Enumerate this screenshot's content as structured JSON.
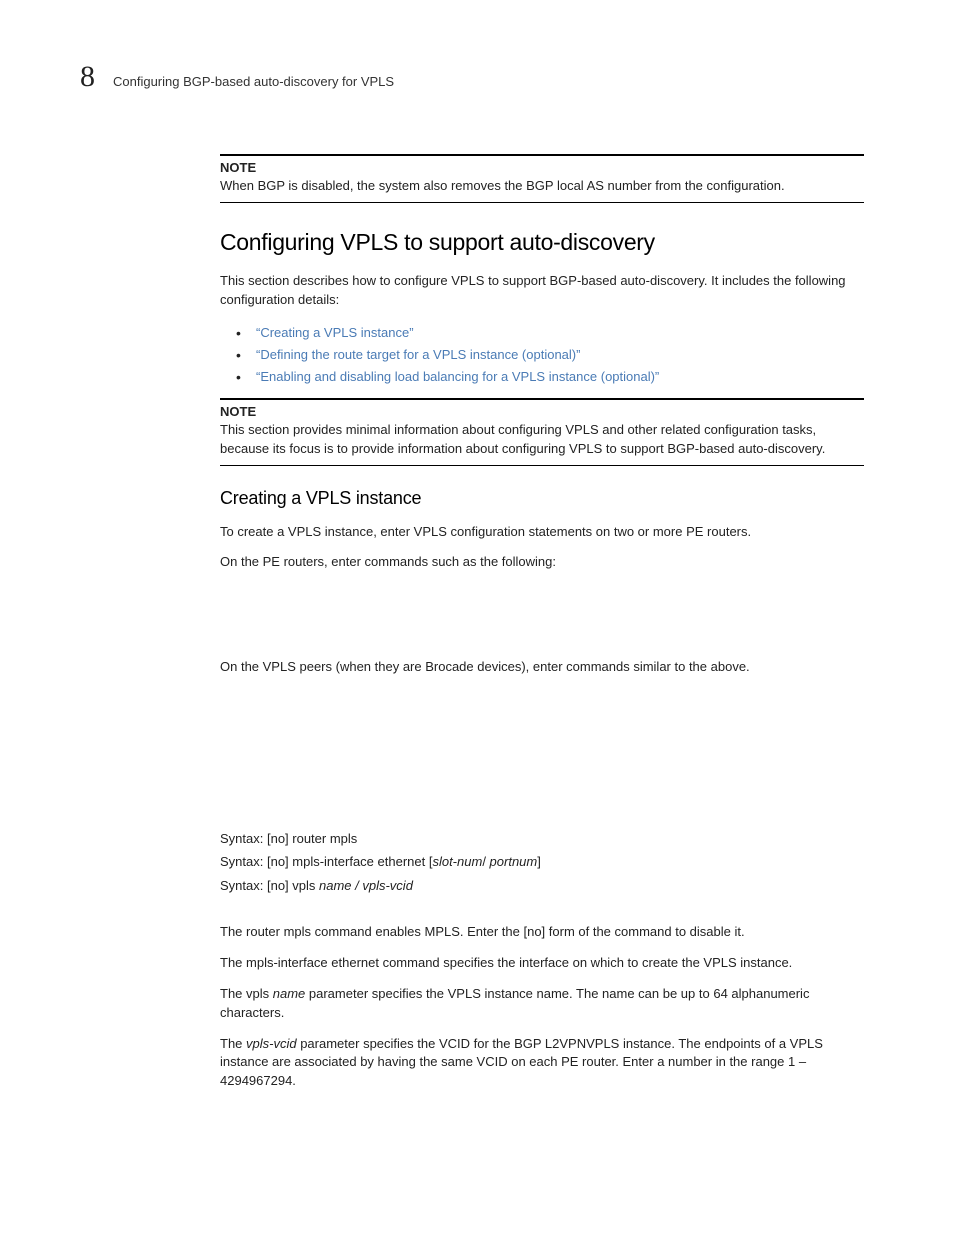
{
  "header": {
    "chapter_number": "8",
    "running_title": "Configuring BGP-based auto-discovery for VPLS"
  },
  "note1": {
    "label": "NOTE",
    "text": "When BGP is disabled, the system also removes the BGP local AS number from the configuration."
  },
  "section": {
    "title": "Configuring VPLS to support auto-discovery",
    "intro": "This section describes how to configure VPLS to support BGP-based auto-discovery. It includes the following configuration details:",
    "bullets": [
      "“Creating a VPLS instance”",
      "“Defining the route target for a VPLS instance (optional)”",
      "“Enabling and disabling load balancing for a VPLS instance (optional)”"
    ]
  },
  "note2": {
    "label": "NOTE",
    "text": "This section provides minimal information about configuring VPLS and other related configuration tasks, because its focus is to provide information about configuring VPLS to support BGP-based auto-discovery."
  },
  "subsection": {
    "title": "Creating a VPLS instance",
    "p1": "To create a VPLS instance, enter VPLS configuration statements on two or more PE routers.",
    "p2": "On the PE routers, enter commands such as the following:",
    "p3": "On the VPLS peers (when they are Brocade devices), enter commands similar to the above.",
    "syntax": {
      "prefix": "Syntax:",
      "line1_a": " [no] router mpls",
      "line2_a": " [no] mpls-interface ethernet [",
      "line2_b": "slot-num",
      "line2_c": "/ ",
      "line2_d": "portnum",
      "line2_e": "]",
      "line3_a": " [no] vpls  ",
      "line3_b": "name / vpls-vcid"
    },
    "p4": "The router mpls command enables MPLS. Enter the [no] form of the command to disable it.",
    "p5": "The mpls-interface ethernet command specifies the interface on which to create the VPLS instance.",
    "p6_a": "The vpls ",
    "p6_b": "name",
    "p6_c": " parameter specifies the VPLS instance name. The name can be up to 64 alphanumeric characters.",
    "p7_a": "The ",
    "p7_b": "vpls-vcid",
    "p7_c": " parameter specifies the VCID for the BGP L2VPNVPLS instance. The endpoints of a VPLS instance are associated by having the same VCID on each PE router. Enter a number in the range 1 – 4294967294."
  }
}
